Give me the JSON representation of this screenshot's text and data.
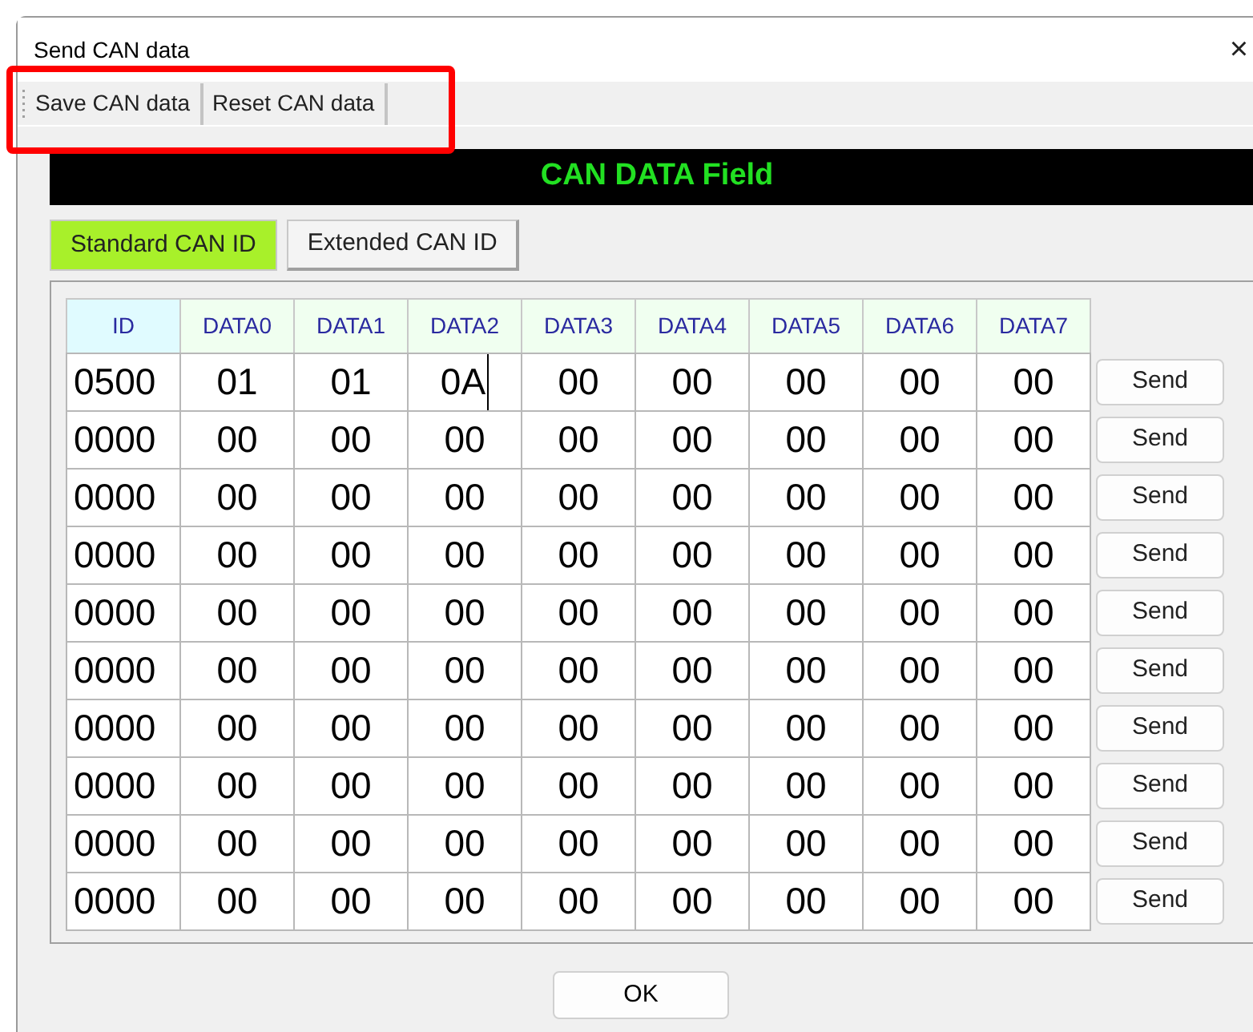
{
  "window": {
    "title": "Send CAN data",
    "close": "×"
  },
  "toolbar": [
    "Save CAN data",
    "Reset CAN data"
  ],
  "highlight": {
    "on": true
  },
  "banner": "CAN DATA Field",
  "tabs": [
    {
      "label": "Standard CAN ID",
      "selected": true
    },
    {
      "label": "Extended CAN ID",
      "selected": false
    }
  ],
  "table": {
    "columns": [
      "ID",
      "DATA0",
      "DATA1",
      "DATA2",
      "DATA3",
      "DATA4",
      "DATA5",
      "DATA6",
      "DATA7"
    ],
    "rows": [
      {
        "cells": [
          {
            "text": "0500",
            "focused": false
          },
          {
            "text": "01",
            "focused": false
          },
          {
            "text": "01",
            "focused": false
          },
          {
            "text": "0A",
            "focused": true
          },
          {
            "text": "00",
            "focused": false
          },
          {
            "text": "00",
            "focused": false
          },
          {
            "text": "00",
            "focused": false
          },
          {
            "text": "00",
            "focused": false
          },
          {
            "text": "00",
            "focused": false
          }
        ],
        "button": "Send"
      },
      {
        "cells": [
          {
            "text": "0000",
            "focused": false
          },
          {
            "text": "00",
            "focused": false
          },
          {
            "text": "00",
            "focused": false
          },
          {
            "text": "00",
            "focused": false
          },
          {
            "text": "00",
            "focused": false
          },
          {
            "text": "00",
            "focused": false
          },
          {
            "text": "00",
            "focused": false
          },
          {
            "text": "00",
            "focused": false
          },
          {
            "text": "00",
            "focused": false
          }
        ],
        "button": "Send"
      },
      {
        "cells": [
          {
            "text": "0000",
            "focused": false
          },
          {
            "text": "00",
            "focused": false
          },
          {
            "text": "00",
            "focused": false
          },
          {
            "text": "00",
            "focused": false
          },
          {
            "text": "00",
            "focused": false
          },
          {
            "text": "00",
            "focused": false
          },
          {
            "text": "00",
            "focused": false
          },
          {
            "text": "00",
            "focused": false
          },
          {
            "text": "00",
            "focused": false
          }
        ],
        "button": "Send"
      },
      {
        "cells": [
          {
            "text": "0000",
            "focused": false
          },
          {
            "text": "00",
            "focused": false
          },
          {
            "text": "00",
            "focused": false
          },
          {
            "text": "00",
            "focused": false
          },
          {
            "text": "00",
            "focused": false
          },
          {
            "text": "00",
            "focused": false
          },
          {
            "text": "00",
            "focused": false
          },
          {
            "text": "00",
            "focused": false
          },
          {
            "text": "00",
            "focused": false
          }
        ],
        "button": "Send"
      },
      {
        "cells": [
          {
            "text": "0000",
            "focused": false
          },
          {
            "text": "00",
            "focused": false
          },
          {
            "text": "00",
            "focused": false
          },
          {
            "text": "00",
            "focused": false
          },
          {
            "text": "00",
            "focused": false
          },
          {
            "text": "00",
            "focused": false
          },
          {
            "text": "00",
            "focused": false
          },
          {
            "text": "00",
            "focused": false
          },
          {
            "text": "00",
            "focused": false
          }
        ],
        "button": "Send"
      },
      {
        "cells": [
          {
            "text": "0000",
            "focused": false
          },
          {
            "text": "00",
            "focused": false
          },
          {
            "text": "00",
            "focused": false
          },
          {
            "text": "00",
            "focused": false
          },
          {
            "text": "00",
            "focused": false
          },
          {
            "text": "00",
            "focused": false
          },
          {
            "text": "00",
            "focused": false
          },
          {
            "text": "00",
            "focused": false
          },
          {
            "text": "00",
            "focused": false
          }
        ],
        "button": "Send"
      },
      {
        "cells": [
          {
            "text": "0000",
            "focused": false
          },
          {
            "text": "00",
            "focused": false
          },
          {
            "text": "00",
            "focused": false
          },
          {
            "text": "00",
            "focused": false
          },
          {
            "text": "00",
            "focused": false
          },
          {
            "text": "00",
            "focused": false
          },
          {
            "text": "00",
            "focused": false
          },
          {
            "text": "00",
            "focused": false
          },
          {
            "text": "00",
            "focused": false
          }
        ],
        "button": "Send"
      },
      {
        "cells": [
          {
            "text": "0000",
            "focused": false
          },
          {
            "text": "00",
            "focused": false
          },
          {
            "text": "00",
            "focused": false
          },
          {
            "text": "00",
            "focused": false
          },
          {
            "text": "00",
            "focused": false
          },
          {
            "text": "00",
            "focused": false
          },
          {
            "text": "00",
            "focused": false
          },
          {
            "text": "00",
            "focused": false
          },
          {
            "text": "00",
            "focused": false
          }
        ],
        "button": "Send"
      },
      {
        "cells": [
          {
            "text": "0000",
            "focused": false
          },
          {
            "text": "00",
            "focused": false
          },
          {
            "text": "00",
            "focused": false
          },
          {
            "text": "00",
            "focused": false
          },
          {
            "text": "00",
            "focused": false
          },
          {
            "text": "00",
            "focused": false
          },
          {
            "text": "00",
            "focused": false
          },
          {
            "text": "00",
            "focused": false
          },
          {
            "text": "00",
            "focused": false
          }
        ],
        "button": "Send"
      },
      {
        "cells": [
          {
            "text": "0000",
            "focused": false
          },
          {
            "text": "00",
            "focused": false
          },
          {
            "text": "00",
            "focused": false
          },
          {
            "text": "00",
            "focused": false
          },
          {
            "text": "00",
            "focused": false
          },
          {
            "text": "00",
            "focused": false
          },
          {
            "text": "00",
            "focused": false
          },
          {
            "text": "00",
            "focused": false
          },
          {
            "text": "00",
            "focused": false
          }
        ],
        "button": "Send"
      }
    ]
  },
  "ok_button": "OK"
}
